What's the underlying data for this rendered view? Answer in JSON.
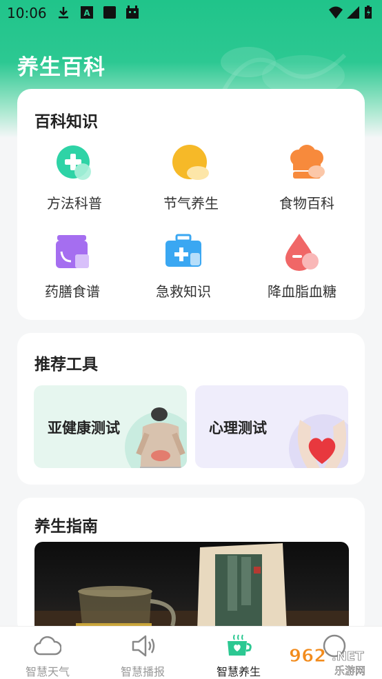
{
  "status_bar": {
    "time": "10:06",
    "icons": [
      "download-icon",
      "a-icon",
      "square-icon",
      "android-icon",
      "wifi-icon",
      "signal-icon",
      "battery-icon"
    ]
  },
  "header": {
    "title": "养生百科"
  },
  "encyclopedia": {
    "title": "百科知识",
    "items": [
      {
        "label": "方法科普",
        "icon": "medical-plus-icon",
        "color": "#2ed3a6"
      },
      {
        "label": "节气养生",
        "icon": "sun-cloud-icon",
        "color": "#f6b928"
      },
      {
        "label": "食物百科",
        "icon": "chef-hat-icon",
        "color": "#f78a3c"
      },
      {
        "label": "药膳食谱",
        "icon": "recipe-jar-icon",
        "color": "#a56ef0"
      },
      {
        "label": "急救知识",
        "icon": "first-aid-kit-icon",
        "color": "#3aa7f2"
      },
      {
        "label": "降血脂血糖",
        "icon": "blood-drop-icon",
        "color": "#f06767"
      }
    ]
  },
  "tools": {
    "title": "推荐工具",
    "items": [
      {
        "label": "亚健康测试",
        "bg": "#e6f6ef"
      },
      {
        "label": "心理测试",
        "bg": "#efedfb"
      }
    ]
  },
  "guide": {
    "title": "养生指南"
  },
  "tabbar": {
    "items": [
      {
        "label": "智慧天气",
        "icon": "cloud-icon",
        "active": false
      },
      {
        "label": "智慧播报",
        "icon": "speaker-icon",
        "active": false
      },
      {
        "label": "智慧养生",
        "icon": "tea-cup-icon",
        "active": true
      },
      {
        "label": "",
        "icon": "smile-icon",
        "active": false
      }
    ]
  },
  "watermark": {
    "text": "962.NET",
    "subtext": "乐游网"
  },
  "colors": {
    "brand": "#20c48a",
    "background": "#f5f6f7"
  }
}
